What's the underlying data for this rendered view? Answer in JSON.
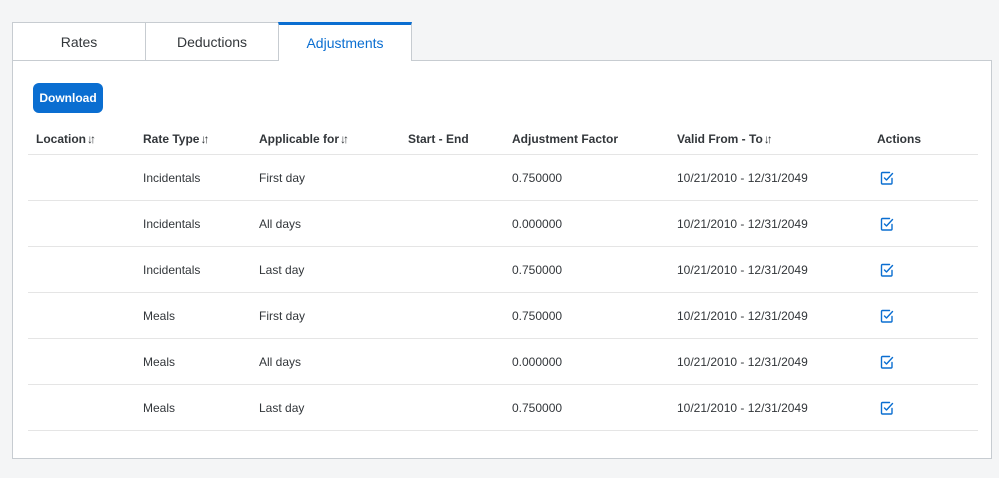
{
  "tabs": [
    {
      "label": "Rates",
      "active": false
    },
    {
      "label": "Deductions",
      "active": false
    },
    {
      "label": "Adjustments",
      "active": true
    }
  ],
  "toolbar": {
    "download_label": "Download"
  },
  "table": {
    "headers": {
      "location": "Location",
      "rate_type": "Rate Type",
      "applicable_for": "Applicable for",
      "start_end": "Start - End",
      "adjustment_factor": "Adjustment Factor",
      "valid_from_to": "Valid From - To",
      "actions": "Actions"
    },
    "sort_glyph": "↓↑",
    "rows": [
      {
        "location": "",
        "rate_type": "Incidentals",
        "applicable_for": "First day",
        "start_end": "",
        "adjustment_factor": "0.750000",
        "valid_from_to": "10/21/2010 - 12/31/2049"
      },
      {
        "location": "",
        "rate_type": "Incidentals",
        "applicable_for": "All days",
        "start_end": "",
        "adjustment_factor": "0.000000",
        "valid_from_to": "10/21/2010 - 12/31/2049"
      },
      {
        "location": "",
        "rate_type": "Incidentals",
        "applicable_for": "Last day",
        "start_end": "",
        "adjustment_factor": "0.750000",
        "valid_from_to": "10/21/2010 - 12/31/2049"
      },
      {
        "location": "",
        "rate_type": "Meals",
        "applicable_for": "First day",
        "start_end": "",
        "adjustment_factor": "0.750000",
        "valid_from_to": "10/21/2010 - 12/31/2049"
      },
      {
        "location": "",
        "rate_type": "Meals",
        "applicable_for": "All days",
        "start_end": "",
        "adjustment_factor": "0.000000",
        "valid_from_to": "10/21/2010 - 12/31/2049"
      },
      {
        "location": "",
        "rate_type": "Meals",
        "applicable_for": "Last day",
        "start_end": "",
        "adjustment_factor": "0.750000",
        "valid_from_to": "10/21/2010 - 12/31/2049"
      }
    ]
  },
  "icons": {
    "row_action": "edit-icon",
    "sort": "sort-icon"
  },
  "colors": {
    "accent": "#0a6ed1",
    "text": "#32363a",
    "border": "#c7ccd1",
    "background": "#f4f5f6"
  }
}
